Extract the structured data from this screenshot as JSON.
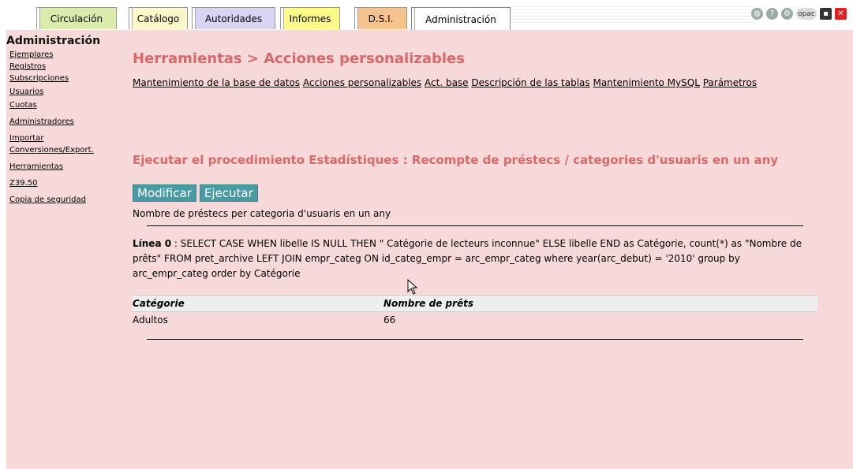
{
  "tabs": [
    {
      "label": "Circulación",
      "color": "#dbecaa"
    },
    {
      "label": "Catálogo",
      "color": "#fdf8c8"
    },
    {
      "label": "Autoridades",
      "color": "#d9d4f4"
    },
    {
      "label": "Informes",
      "color": "#fdfb8a"
    },
    {
      "label": "D.S.I.",
      "color": "#f6c38c"
    },
    {
      "label": "Administración",
      "color": "#ffffff",
      "active": true
    }
  ],
  "toolbar": {
    "icons": [
      "globe-icon",
      "help-icon",
      "gear-icon",
      "opac-icon",
      "save-icon",
      "close-icon"
    ],
    "opac_label": "opac"
  },
  "sidebar": {
    "title": "Administración",
    "items": [
      {
        "label": "Ejemplares"
      },
      {
        "label": "Registros"
      },
      {
        "label": "Subscripciones"
      },
      {
        "label": "Usuarios"
      },
      {
        "label": "Cuotas"
      },
      {
        "label": "Administradores"
      },
      {
        "label": "Importar"
      },
      {
        "label": "Conversiones/Export."
      },
      {
        "label": "Herramientas"
      },
      {
        "label": "Z39.50"
      },
      {
        "label": "Copia de seguridad"
      }
    ]
  },
  "main": {
    "heading": "Herramientas > Acciones personalizables",
    "tool_links": [
      "Mantenimiento de la base de datos",
      "Acciones personalizables",
      "Act. base",
      "Descripción de las tablas",
      "Mantenimiento MySQL",
      "Parámetros"
    ],
    "procedure_title": "Ejecutar el procedimiento Estadístiques : Recompte de préstecs / categories d'usuaris en un any",
    "buttons": {
      "modify": "Modificar",
      "execute": "Ejecutar"
    },
    "procedure_description": "Nombre de préstecs per categoria d'usuaris en un any",
    "sql": {
      "label": "Línea 0",
      "text": " : SELECT CASE WHEN libelle IS NULL THEN \" Catégorie de lecteurs inconnue\" ELSE libelle END as Catégorie, count(*) as \"Nombre de prêts\" FROM pret_archive LEFT JOIN empr_categ ON id_categ_empr = arc_empr_categ where year(arc_debut) = '2010' group by arc_empr_categ order by Catégorie"
    },
    "result": {
      "columns": [
        "Catégorie",
        "Nombre de prêts"
      ],
      "rows": [
        [
          "Adultos",
          "66"
        ]
      ]
    }
  },
  "colors": {
    "page_bg": "#f7d9d9",
    "heading": "#d96868",
    "button": "#4a9aa6"
  }
}
